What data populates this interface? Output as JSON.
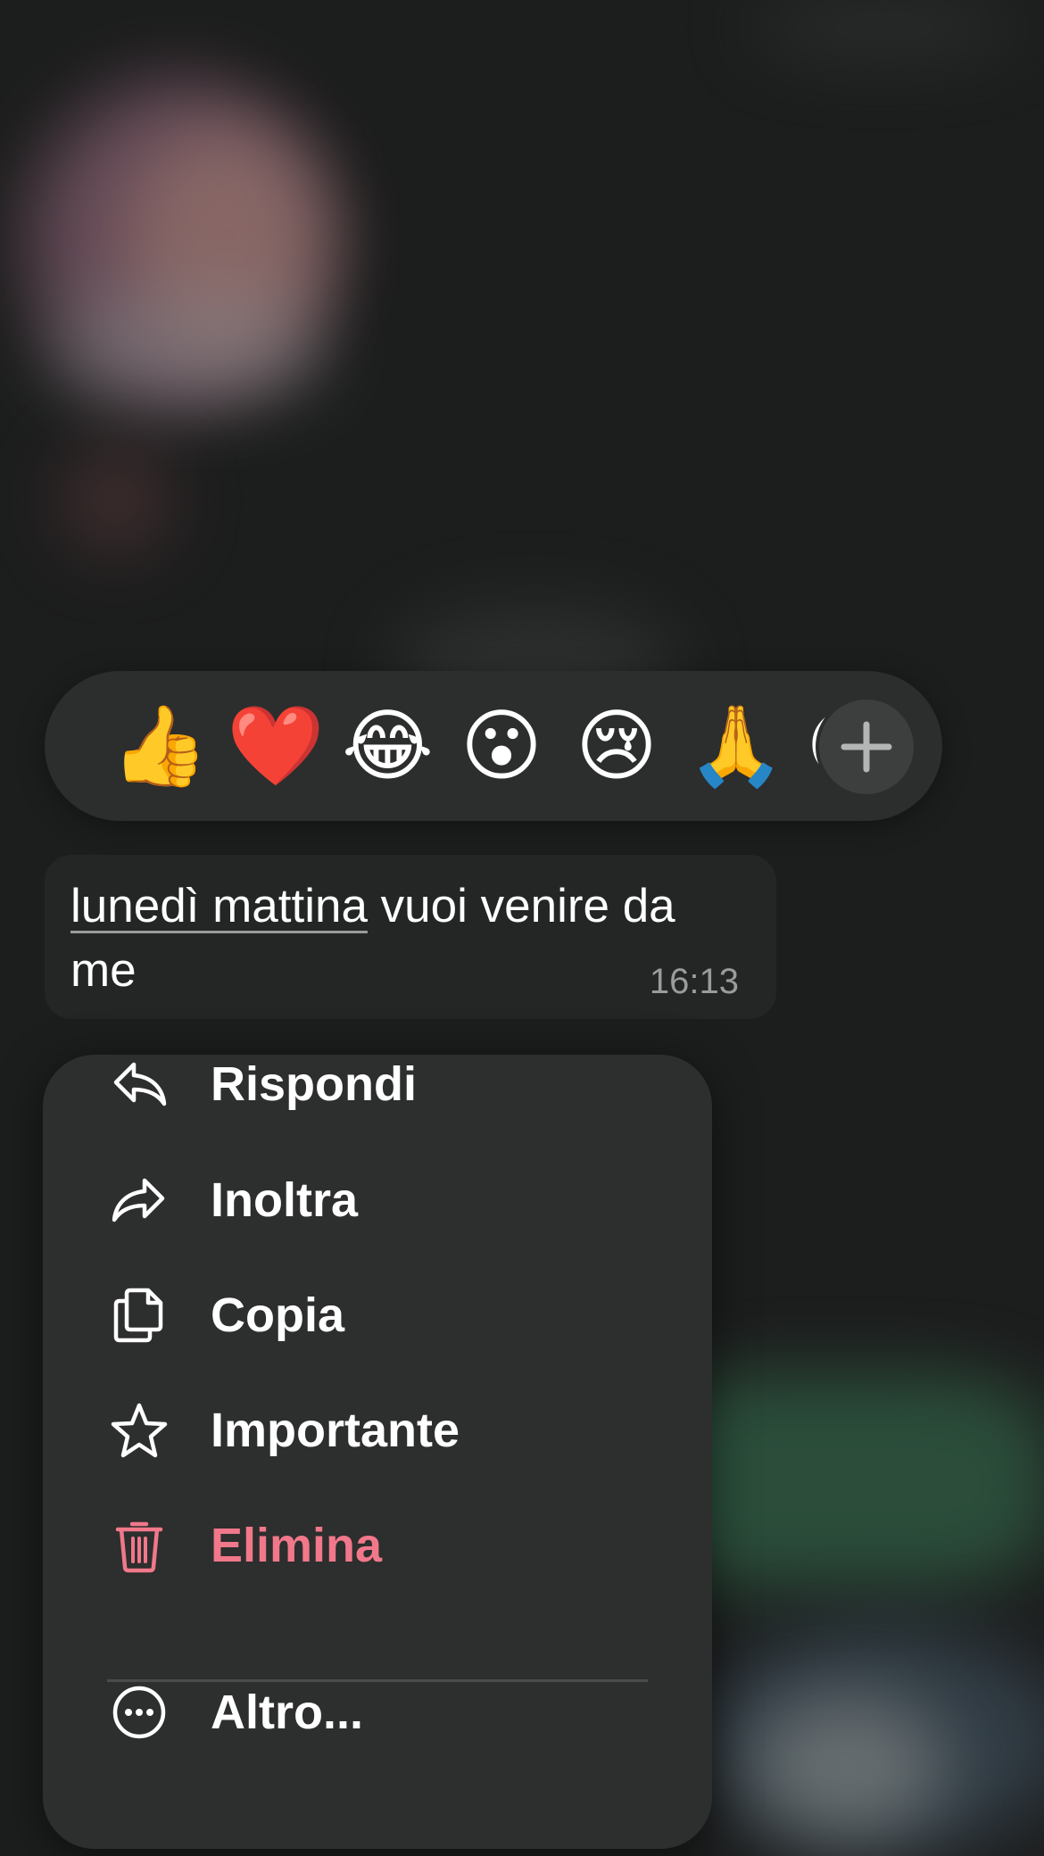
{
  "reactions": {
    "emojis": [
      "👍",
      "❤️",
      "😂",
      "😮",
      "😢",
      "🙏",
      "😍"
    ],
    "more_icon": "plus-icon"
  },
  "message": {
    "link_text": "lunedì mattina",
    "rest_text": " vuoi venire da me",
    "time": "16:13"
  },
  "menu": {
    "items": [
      {
        "label": "Rispondi",
        "icon": "reply-icon"
      },
      {
        "label": "Inoltra",
        "icon": "forward-icon"
      },
      {
        "label": "Copia",
        "icon": "copy-icon"
      },
      {
        "label": "Importante",
        "icon": "star-icon"
      },
      {
        "label": "Elimina",
        "icon": "trash-icon",
        "color": "#f0788a"
      },
      {
        "label": "Altro...",
        "icon": "more-options-icon"
      }
    ]
  }
}
